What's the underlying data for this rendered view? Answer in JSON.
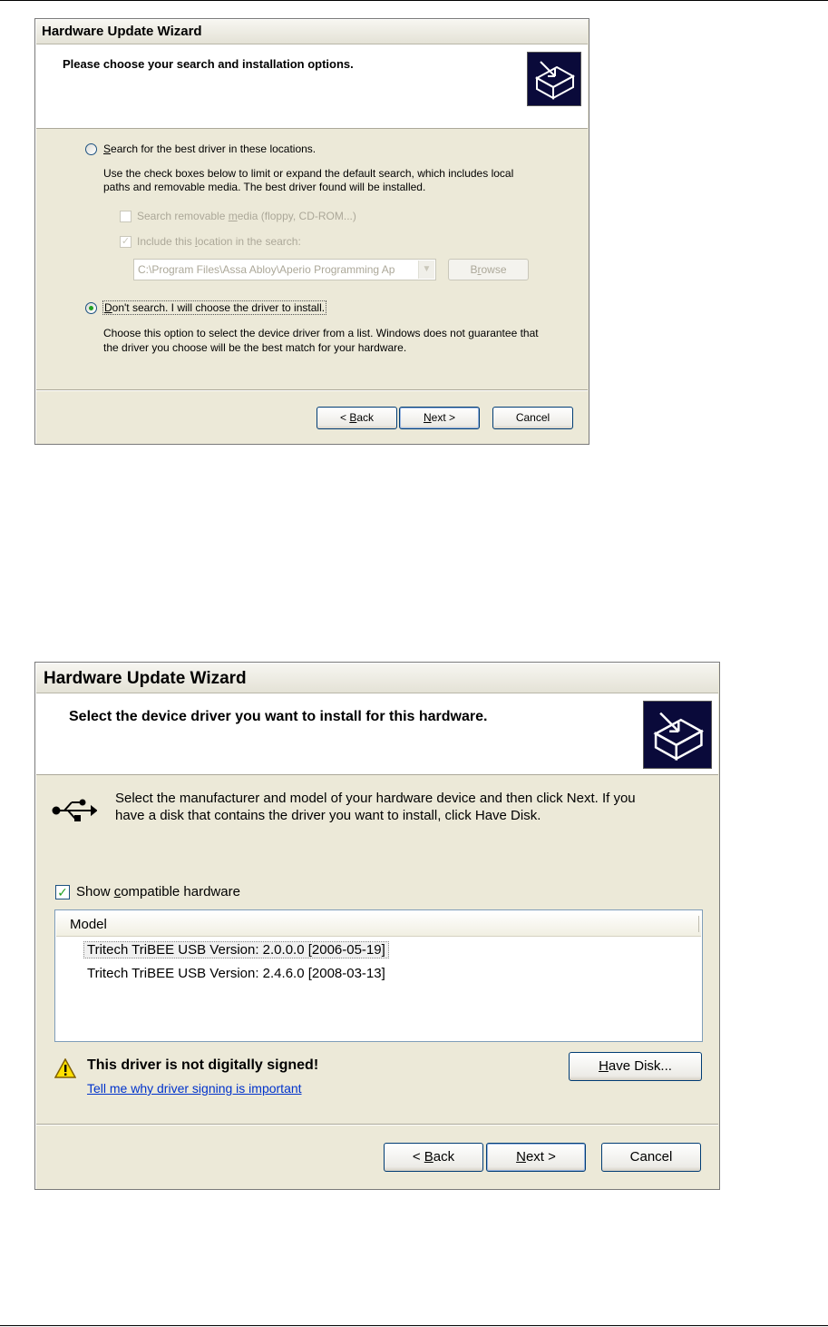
{
  "wizard1": {
    "title": "Hardware Update Wizard",
    "header_title": "Please choose your search and installation options.",
    "radio_search": {
      "label_before": "",
      "label_accel": "S",
      "label_after": "earch for the best driver in these locations.",
      "selected": false
    },
    "search_desc_line1": "Use the check boxes below to limit or expand the default search, which includes local",
    "search_desc_line2": "paths and removable media. The best driver found will be installed.",
    "check_removable": {
      "label_before": "Search removable ",
      "label_accel": "m",
      "label_after": "edia (floppy, CD-ROM...)",
      "checked": false
    },
    "check_include": {
      "label_before": "Include this ",
      "label_accel": "l",
      "label_after": "ocation in the search:",
      "checked": true
    },
    "location_value": "C:\\Program Files\\Assa Abloy\\Aperio Programming Ap",
    "browse_before": "B",
    "browse_accel": "r",
    "browse_after": "owse",
    "radio_dont": {
      "label_accel": "D",
      "label_after": "on't search. I will choose the driver to install.",
      "selected": true
    },
    "dont_desc_line1": "Choose this option to select the device driver from a list.  Windows does not guarantee that",
    "dont_desc_line2": "the driver you choose will be the best match for your hardware.",
    "back_prefix": "< ",
    "back_accel": "B",
    "back_after": "ack",
    "next_accel": "N",
    "next_after": "ext >",
    "cancel_label": "Cancel"
  },
  "wizard2": {
    "title": "Hardware Update Wizard",
    "header_title": "Select the device driver you want to install for this hardware.",
    "intro_line1": "Select the manufacturer and model of your hardware device and then click Next. If you",
    "intro_line2": "have a disk that contains the driver you want to install, click Have Disk.",
    "show_compat": {
      "label_before": "Show ",
      "label_accel": "c",
      "label_after": "ompatible hardware",
      "checked": true
    },
    "list_header": "Model",
    "models": [
      "Tritech TriBEE USB Version: 2.0.0.0 [2006-05-19]",
      "Tritech TriBEE USB Version: 2.4.6.0 [2008-03-13]"
    ],
    "warning_text": "This driver is not digitally signed!",
    "warning_link": "Tell me why driver signing is important",
    "have_disk_accel": "H",
    "have_disk_after": "ave Disk...",
    "back_prefix": "< ",
    "back_accel": "B",
    "back_after": "ack",
    "next_accel": "N",
    "next_after": "ext >",
    "cancel_label": "Cancel"
  },
  "icons": {
    "wizard_header_icon": "hardware-board-icon",
    "usb_icon": "usb-icon",
    "warning_icon": "warning-icon"
  },
  "colors": {
    "dialog_bg": "#ece9d8",
    "selection_dot": "#21a121",
    "link": "#0033cc"
  }
}
